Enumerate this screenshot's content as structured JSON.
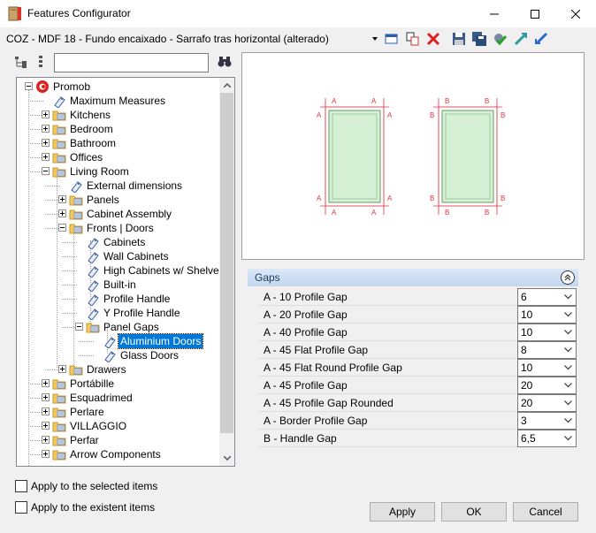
{
  "window": {
    "title": "Features Configurator"
  },
  "toolbar": {
    "config_name": "COZ - MDF 18 - Fundo encaixado - Sarrafo tras horizontal (alterado)"
  },
  "tree": {
    "search_value": "",
    "items": [
      {
        "label": "Promob"
      },
      {
        "label": "Maximum Measures"
      },
      {
        "label": "Kitchens"
      },
      {
        "label": "Bedroom"
      },
      {
        "label": "Bathroom"
      },
      {
        "label": "Offices"
      },
      {
        "label": "Living Room"
      },
      {
        "label": "External dimensions"
      },
      {
        "label": "Panels"
      },
      {
        "label": "Cabinet Assembly"
      },
      {
        "label": "Fronts | Doors"
      },
      {
        "label": "Cabinets"
      },
      {
        "label": "Wall Cabinets"
      },
      {
        "label": "High Cabinets w/ Shelves"
      },
      {
        "label": "Built-in"
      },
      {
        "label": "Profile Handle"
      },
      {
        "label": "Y Profile Handle"
      },
      {
        "label": "Panel Gaps"
      },
      {
        "label": "Aluminium Doors"
      },
      {
        "label": "Glass Doors"
      },
      {
        "label": "Drawers"
      },
      {
        "label": "Portábille"
      },
      {
        "label": "Esquadrimed"
      },
      {
        "label": "Perlare"
      },
      {
        "label": "VILLAGGIO"
      },
      {
        "label": "Perfar"
      },
      {
        "label": "Arrow Components"
      }
    ]
  },
  "preview": {
    "label_a": "A",
    "label_b": "B"
  },
  "gaps": {
    "title": "Gaps",
    "rows": [
      {
        "label": "A - 10 Profile Gap",
        "value": "6"
      },
      {
        "label": "A - 20 Profile Gap",
        "value": "10"
      },
      {
        "label": "A - 40 Profile Gap",
        "value": "10"
      },
      {
        "label": "A - 45 Flat Profile Gap",
        "value": "8"
      },
      {
        "label": "A - 45 Flat Round Profile Gap",
        "value": "10"
      },
      {
        "label": "A - 45 Profile Gap",
        "value": "20"
      },
      {
        "label": "A - 45 Profile Gap Rounded",
        "value": "20"
      },
      {
        "label": "A - Border Profile Gap",
        "value": "3"
      },
      {
        "label": "B - Handle Gap",
        "value": "6,5"
      }
    ]
  },
  "options": {
    "apply_selected": "Apply to the selected items",
    "apply_existent": "Apply to the existent items"
  },
  "buttons": {
    "apply": "Apply",
    "ok": "OK",
    "cancel": "Cancel"
  },
  "colors": {
    "selection": "#0078d7",
    "dimension_red": "#e8303c",
    "door_fill": "#d6f0d6",
    "header_blue": "#c3d7ef"
  }
}
